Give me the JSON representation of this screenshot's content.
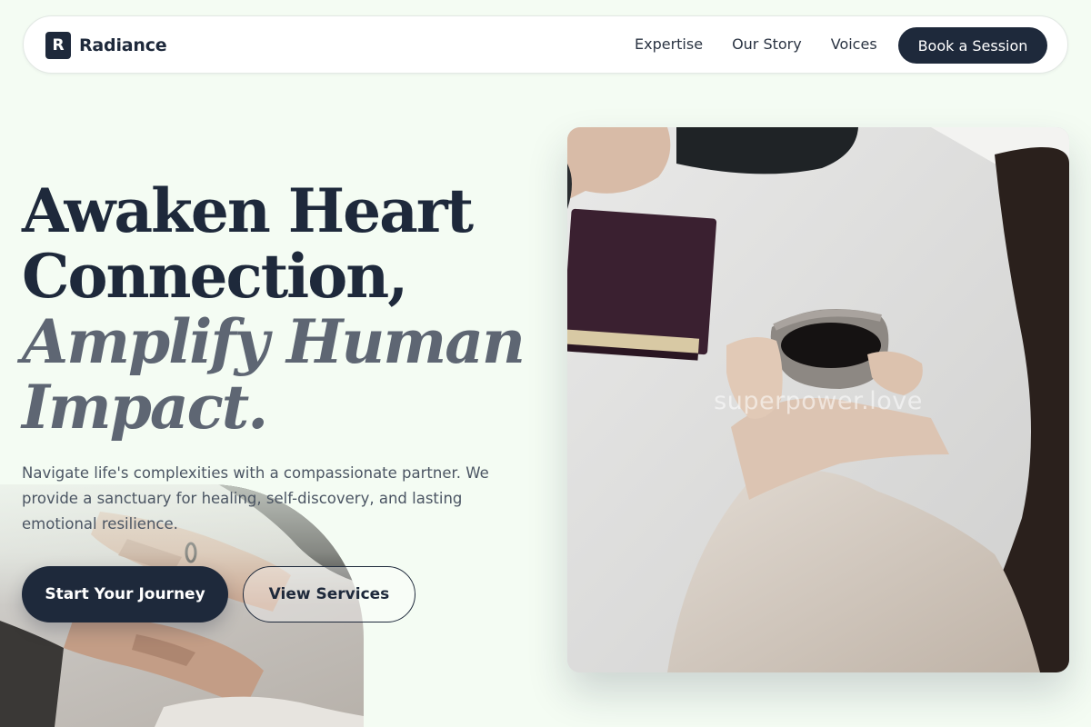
{
  "brand": {
    "logo_letter": "R",
    "name": "Radiance"
  },
  "nav": {
    "links": [
      "Expertise",
      "Our Story",
      "Voices"
    ],
    "cta": "Book a Session"
  },
  "hero": {
    "headline_line1": "Awaken Heart",
    "headline_line2": "Connection,",
    "headline_line3": "Amplify Human",
    "headline_line4": "Impact.",
    "description": "Navigate life's complexities with a compassionate partner. We provide a sanctuary for healing, self-discovery, and lasting emotional resilience.",
    "primary_button": "Start Your Journey",
    "secondary_button": "View Services"
  },
  "image": {
    "watermark": "superpower.love"
  },
  "colors": {
    "background": "#f4fcf3",
    "primary": "#1e293b",
    "accent_text": "#5e6673",
    "body_text": "#4b5563"
  }
}
